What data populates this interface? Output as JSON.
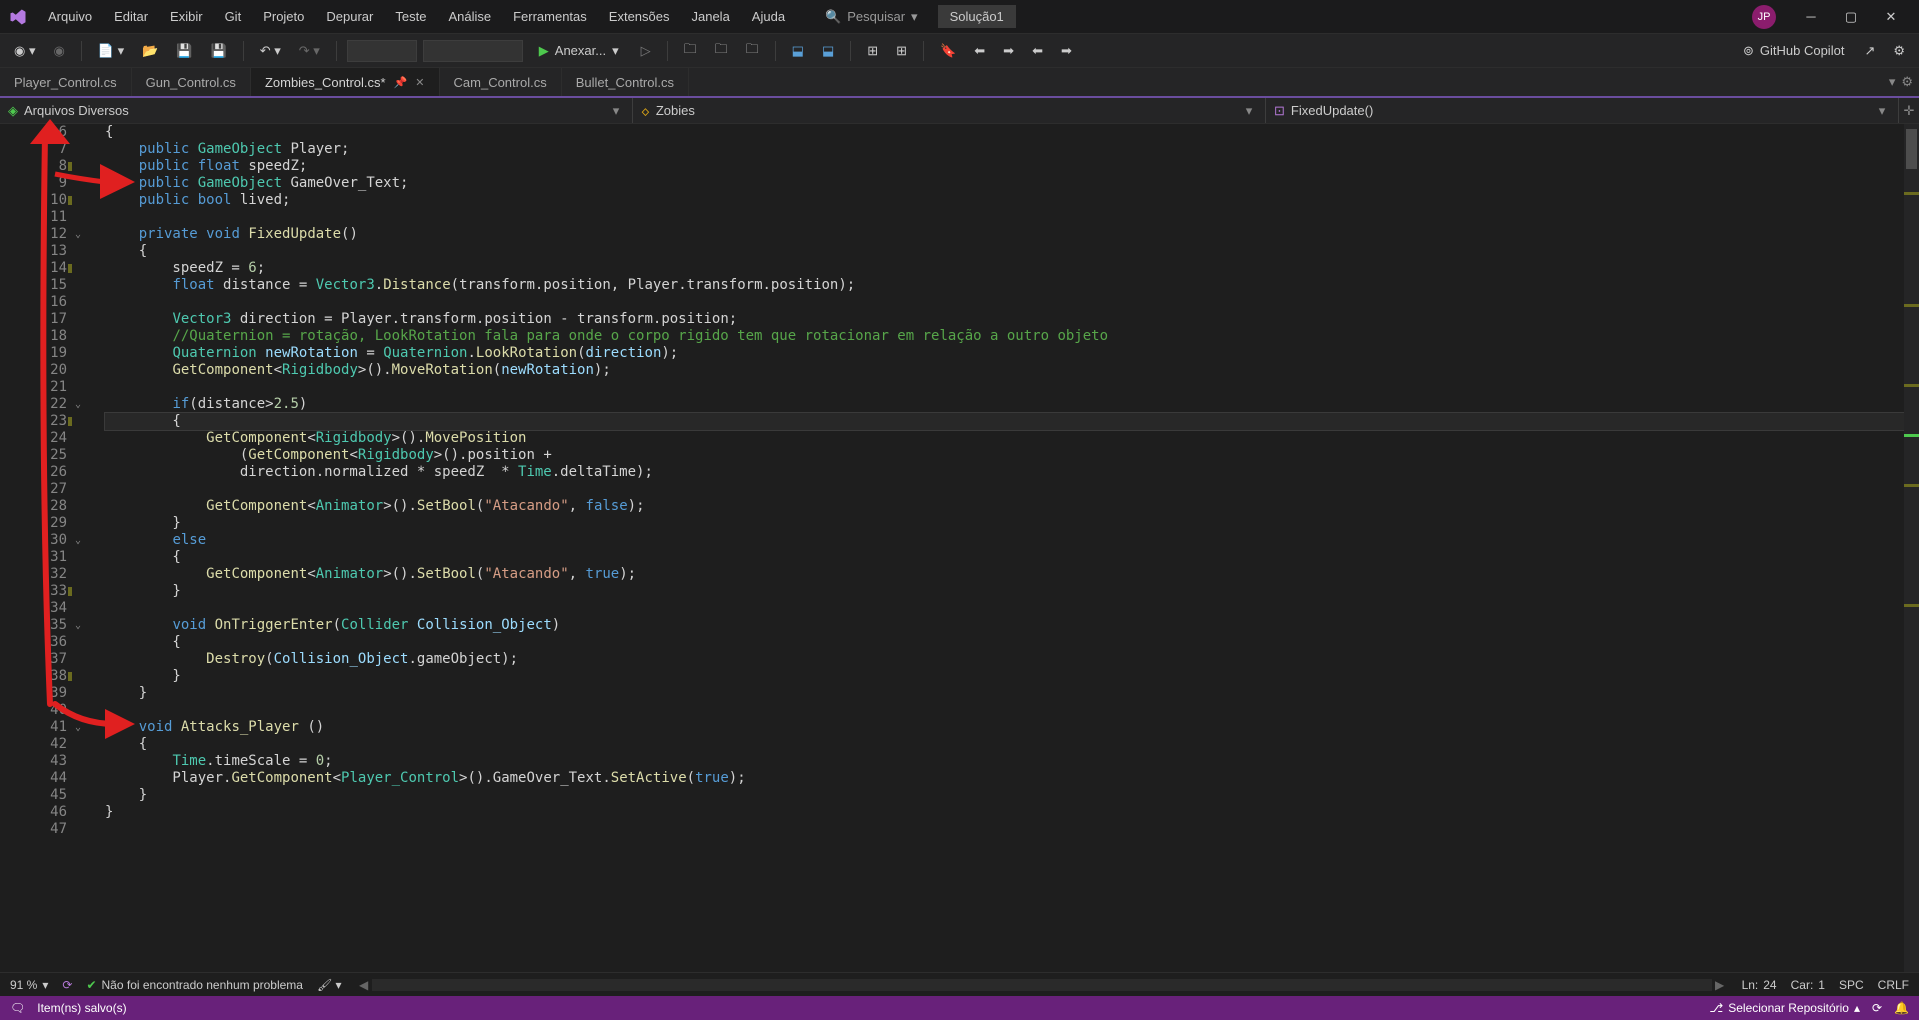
{
  "titlebar": {
    "menus": [
      "Arquivo",
      "Editar",
      "Exibir",
      "Git",
      "Projeto",
      "Depurar",
      "Teste",
      "Análise",
      "Ferramentas",
      "Extensões",
      "Janela",
      "Ajuda"
    ],
    "search": "Pesquisar",
    "solution": "Solução1",
    "avatar": "JP"
  },
  "toolbar": {
    "anexar": "Anexar...",
    "copilot": "GitHub Copilot"
  },
  "tabs": [
    {
      "label": "Player_Control.cs",
      "active": false
    },
    {
      "label": "Gun_Control.cs",
      "active": false
    },
    {
      "label": "Zombies_Control.cs*",
      "active": true
    },
    {
      "label": "Cam_Control.cs",
      "active": false
    },
    {
      "label": "Bullet_Control.cs",
      "active": false
    }
  ],
  "nav": {
    "project": "Arquivos Diversos",
    "class": "Zobies",
    "member": "FixedUpdate()"
  },
  "code": {
    "first_line": 6,
    "current_line": 23,
    "lines": [
      {
        "n": 6,
        "t": [
          {
            "c": "punc",
            "s": "{"
          }
        ]
      },
      {
        "n": 7,
        "t": [
          {
            "c": "",
            "s": "    "
          },
          {
            "c": "kw",
            "s": "public"
          },
          {
            "c": "",
            "s": " "
          },
          {
            "c": "type",
            "s": "GameObject"
          },
          {
            "c": "",
            "s": " Player;"
          }
        ]
      },
      {
        "n": 8,
        "mk": true,
        "t": [
          {
            "c": "",
            "s": "    "
          },
          {
            "c": "kw",
            "s": "public"
          },
          {
            "c": "",
            "s": " "
          },
          {
            "c": "kw",
            "s": "float"
          },
          {
            "c": "",
            "s": " speedZ;"
          }
        ]
      },
      {
        "n": 9,
        "t": [
          {
            "c": "",
            "s": "    "
          },
          {
            "c": "kw",
            "s": "public"
          },
          {
            "c": "",
            "s": " "
          },
          {
            "c": "type",
            "s": "GameObject"
          },
          {
            "c": "",
            "s": " GameOver_Text;"
          }
        ]
      },
      {
        "n": 10,
        "mk": true,
        "t": [
          {
            "c": "",
            "s": "    "
          },
          {
            "c": "kw",
            "s": "public"
          },
          {
            "c": "",
            "s": " "
          },
          {
            "c": "kw",
            "s": "bool"
          },
          {
            "c": "",
            "s": " lived;"
          }
        ]
      },
      {
        "n": 11,
        "t": [
          {
            "c": "",
            "s": ""
          }
        ]
      },
      {
        "n": 12,
        "fold": true,
        "t": [
          {
            "c": "",
            "s": "    "
          },
          {
            "c": "kw",
            "s": "private"
          },
          {
            "c": "",
            "s": " "
          },
          {
            "c": "kw",
            "s": "void"
          },
          {
            "c": "",
            "s": " "
          },
          {
            "c": "method",
            "s": "FixedUpdate"
          },
          {
            "c": "",
            "s": "()"
          }
        ]
      },
      {
        "n": 13,
        "t": [
          {
            "c": "",
            "s": "    {"
          }
        ]
      },
      {
        "n": 14,
        "mk": true,
        "t": [
          {
            "c": "",
            "s": "        speedZ = "
          },
          {
            "c": "num",
            "s": "6"
          },
          {
            "c": "",
            "s": ";"
          }
        ]
      },
      {
        "n": 15,
        "t": [
          {
            "c": "",
            "s": "        "
          },
          {
            "c": "kw",
            "s": "float"
          },
          {
            "c": "",
            "s": " distance = "
          },
          {
            "c": "type",
            "s": "Vector3"
          },
          {
            "c": "",
            "s": "."
          },
          {
            "c": "method",
            "s": "Distance"
          },
          {
            "c": "",
            "s": "(transform.position, Player.transform.position);"
          }
        ]
      },
      {
        "n": 16,
        "t": [
          {
            "c": "",
            "s": ""
          }
        ]
      },
      {
        "n": 17,
        "t": [
          {
            "c": "",
            "s": "        "
          },
          {
            "c": "type",
            "s": "Vector3"
          },
          {
            "c": "",
            "s": " direction = Player.transform.position - transform.position;"
          }
        ]
      },
      {
        "n": 18,
        "t": [
          {
            "c": "",
            "s": "        "
          },
          {
            "c": "comm",
            "s": "//Quaternion = rotação, LookRotation fala para onde o corpo rigido tem que rotacionar em relação a outro objeto"
          }
        ]
      },
      {
        "n": 19,
        "t": [
          {
            "c": "",
            "s": "        "
          },
          {
            "c": "type",
            "s": "Quaternion"
          },
          {
            "c": "",
            "s": " "
          },
          {
            "c": "param",
            "s": "newRotation"
          },
          {
            "c": "",
            "s": " = "
          },
          {
            "c": "type",
            "s": "Quaternion"
          },
          {
            "c": "",
            "s": "."
          },
          {
            "c": "method",
            "s": "LookRotation"
          },
          {
            "c": "",
            "s": "("
          },
          {
            "c": "param",
            "s": "direction"
          },
          {
            "c": "",
            "s": ");"
          }
        ]
      },
      {
        "n": 20,
        "t": [
          {
            "c": "",
            "s": "        "
          },
          {
            "c": "method",
            "s": "GetComponent"
          },
          {
            "c": "",
            "s": "<"
          },
          {
            "c": "type",
            "s": "Rigidbody"
          },
          {
            "c": "",
            "s": ">()."
          },
          {
            "c": "method",
            "s": "MoveRotation"
          },
          {
            "c": "",
            "s": "("
          },
          {
            "c": "param",
            "s": "newRotation"
          },
          {
            "c": "",
            "s": ");"
          }
        ]
      },
      {
        "n": 21,
        "t": [
          {
            "c": "",
            "s": ""
          }
        ]
      },
      {
        "n": 22,
        "fold": true,
        "t": [
          {
            "c": "",
            "s": "        "
          },
          {
            "c": "kw",
            "s": "if"
          },
          {
            "c": "",
            "s": "(distance>"
          },
          {
            "c": "num",
            "s": "2.5"
          },
          {
            "c": "",
            "s": ")"
          }
        ]
      },
      {
        "n": 23,
        "mk": true,
        "t": [
          {
            "c": "",
            "s": "        {"
          }
        ]
      },
      {
        "n": 24,
        "t": [
          {
            "c": "",
            "s": "            "
          },
          {
            "c": "method",
            "s": "GetComponent"
          },
          {
            "c": "",
            "s": "<"
          },
          {
            "c": "type",
            "s": "Rigidbody"
          },
          {
            "c": "",
            "s": ">()."
          },
          {
            "c": "method",
            "s": "MovePosition"
          }
        ]
      },
      {
        "n": 25,
        "t": [
          {
            "c": "",
            "s": "                ("
          },
          {
            "c": "method",
            "s": "GetComponent"
          },
          {
            "c": "",
            "s": "<"
          },
          {
            "c": "type",
            "s": "Rigidbody"
          },
          {
            "c": "",
            "s": ">().position +"
          }
        ]
      },
      {
        "n": 26,
        "t": [
          {
            "c": "",
            "s": "                direction.normalized * speedZ  * "
          },
          {
            "c": "type",
            "s": "Time"
          },
          {
            "c": "",
            "s": ".deltaTime);"
          }
        ]
      },
      {
        "n": 27,
        "t": [
          {
            "c": "",
            "s": ""
          }
        ]
      },
      {
        "n": 28,
        "t": [
          {
            "c": "",
            "s": "            "
          },
          {
            "c": "method",
            "s": "GetComponent"
          },
          {
            "c": "",
            "s": "<"
          },
          {
            "c": "type",
            "s": "Animator"
          },
          {
            "c": "",
            "s": ">()."
          },
          {
            "c": "method",
            "s": "SetBool"
          },
          {
            "c": "",
            "s": "("
          },
          {
            "c": "str",
            "s": "\"Atacando\""
          },
          {
            "c": "",
            "s": ", "
          },
          {
            "c": "kw",
            "s": "false"
          },
          {
            "c": "",
            "s": ");"
          }
        ]
      },
      {
        "n": 29,
        "t": [
          {
            "c": "",
            "s": "        }"
          }
        ]
      },
      {
        "n": 30,
        "fold": true,
        "t": [
          {
            "c": "",
            "s": "        "
          },
          {
            "c": "kw",
            "s": "else"
          }
        ]
      },
      {
        "n": 31,
        "t": [
          {
            "c": "",
            "s": "        {"
          }
        ]
      },
      {
        "n": 32,
        "t": [
          {
            "c": "",
            "s": "            "
          },
          {
            "c": "method",
            "s": "GetComponent"
          },
          {
            "c": "",
            "s": "<"
          },
          {
            "c": "type",
            "s": "Animator"
          },
          {
            "c": "",
            "s": ">()."
          },
          {
            "c": "method",
            "s": "SetBool"
          },
          {
            "c": "",
            "s": "("
          },
          {
            "c": "str",
            "s": "\"Atacando\""
          },
          {
            "c": "",
            "s": ", "
          },
          {
            "c": "kw",
            "s": "true"
          },
          {
            "c": "",
            "s": ");"
          }
        ]
      },
      {
        "n": 33,
        "mk": true,
        "t": [
          {
            "c": "",
            "s": "        }"
          }
        ]
      },
      {
        "n": 34,
        "t": [
          {
            "c": "",
            "s": ""
          }
        ]
      },
      {
        "n": 35,
        "fold": true,
        "t": [
          {
            "c": "",
            "s": "        "
          },
          {
            "c": "kw",
            "s": "void"
          },
          {
            "c": "",
            "s": " "
          },
          {
            "c": "method",
            "s": "OnTriggerEnter"
          },
          {
            "c": "",
            "s": "("
          },
          {
            "c": "type",
            "s": "Collider"
          },
          {
            "c": "",
            "s": " "
          },
          {
            "c": "param",
            "s": "Collision_Object"
          },
          {
            "c": "",
            "s": ")"
          }
        ]
      },
      {
        "n": 36,
        "t": [
          {
            "c": "",
            "s": "        {"
          }
        ]
      },
      {
        "n": 37,
        "t": [
          {
            "c": "",
            "s": "            "
          },
          {
            "c": "method",
            "s": "Destroy"
          },
          {
            "c": "",
            "s": "("
          },
          {
            "c": "param",
            "s": "Collision_Object"
          },
          {
            "c": "",
            "s": ".gameObject);"
          }
        ]
      },
      {
        "n": 38,
        "mk": true,
        "t": [
          {
            "c": "",
            "s": "        }"
          }
        ]
      },
      {
        "n": 39,
        "t": [
          {
            "c": "",
            "s": "    }"
          }
        ]
      },
      {
        "n": 40,
        "t": [
          {
            "c": "",
            "s": ""
          }
        ]
      },
      {
        "n": 41,
        "fold": true,
        "t": [
          {
            "c": "",
            "s": "    "
          },
          {
            "c": "kw",
            "s": "void"
          },
          {
            "c": "",
            "s": " "
          },
          {
            "c": "method",
            "s": "Attacks_Player"
          },
          {
            "c": "",
            "s": " ()"
          }
        ]
      },
      {
        "n": 42,
        "t": [
          {
            "c": "",
            "s": "    {"
          }
        ]
      },
      {
        "n": 43,
        "t": [
          {
            "c": "",
            "s": "        "
          },
          {
            "c": "type",
            "s": "Time"
          },
          {
            "c": "",
            "s": ".timeScale = "
          },
          {
            "c": "num",
            "s": "0"
          },
          {
            "c": "",
            "s": ";"
          }
        ]
      },
      {
        "n": 44,
        "t": [
          {
            "c": "",
            "s": "        Player."
          },
          {
            "c": "method",
            "s": "GetComponent"
          },
          {
            "c": "",
            "s": "<"
          },
          {
            "c": "type",
            "s": "Player_Control"
          },
          {
            "c": "",
            "s": ">().GameOver_Text."
          },
          {
            "c": "method",
            "s": "SetActive"
          },
          {
            "c": "",
            "s": "("
          },
          {
            "c": "kw",
            "s": "true"
          },
          {
            "c": "",
            "s": ");"
          }
        ]
      },
      {
        "n": 45,
        "t": [
          {
            "c": "",
            "s": "    }"
          }
        ]
      },
      {
        "n": 46,
        "t": [
          {
            "c": "",
            "s": "}"
          }
        ]
      },
      {
        "n": 47,
        "t": [
          {
            "c": "",
            "s": ""
          }
        ]
      }
    ]
  },
  "status1": {
    "zoom": "91 %",
    "problems": "Não foi encontrado nenhum problema",
    "ln_label": "Ln:",
    "ln": "24",
    "col_label": "Car:",
    "col": "1",
    "spc": "SPC",
    "crlf": "CRLF"
  },
  "status2": {
    "saved": "Item(ns) salvo(s)",
    "repo": "Selecionar Repositório"
  }
}
